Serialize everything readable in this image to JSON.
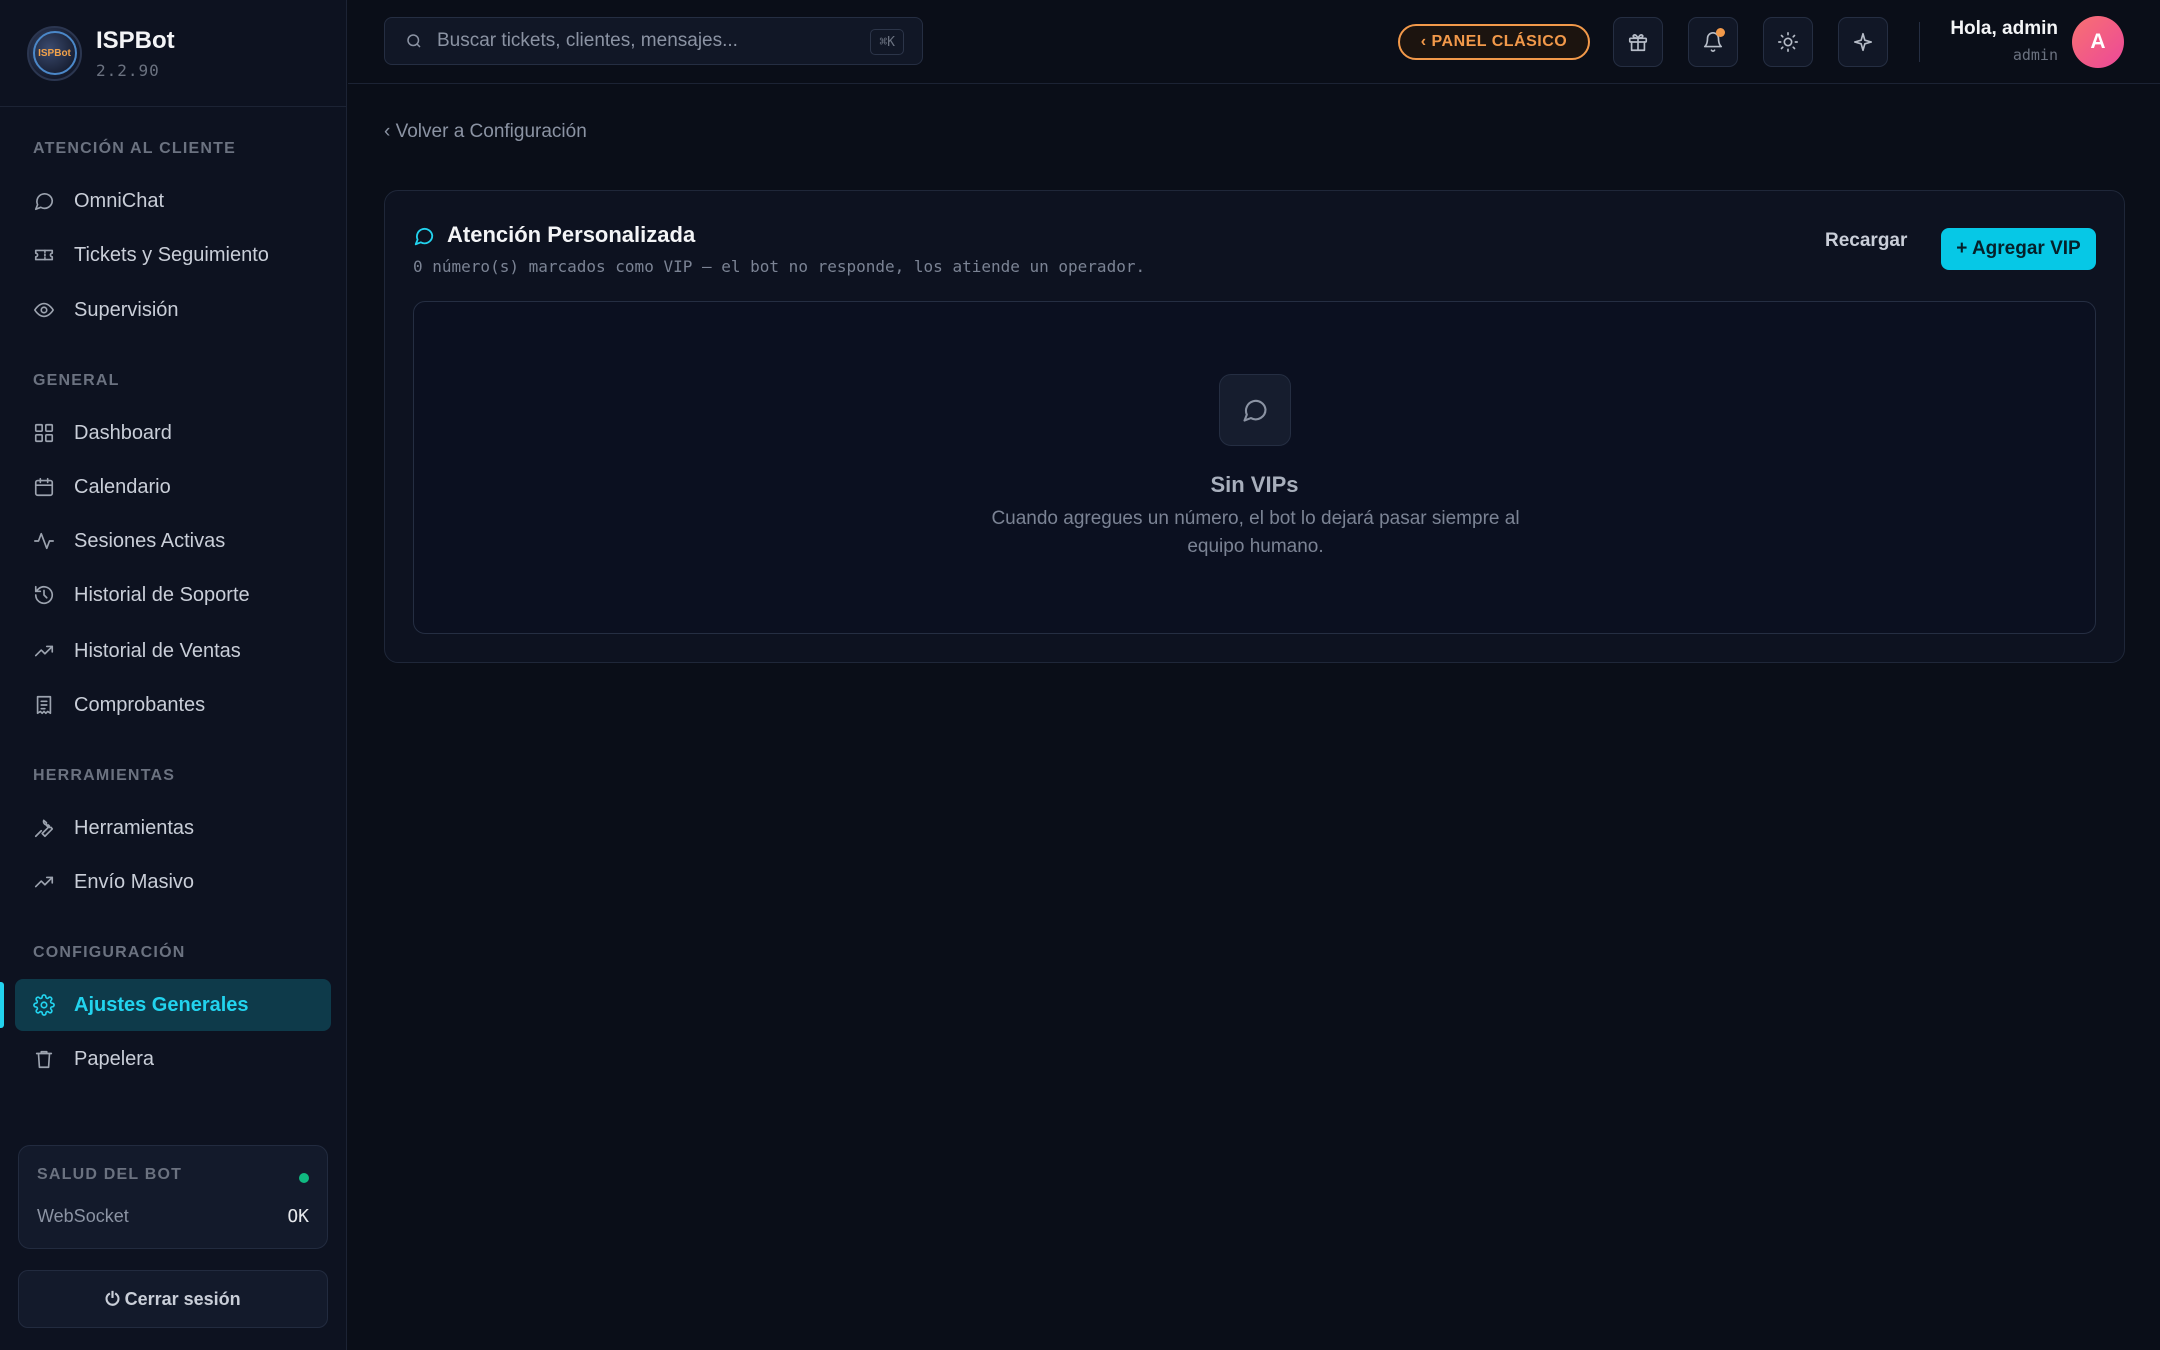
{
  "brand": {
    "name": "ISPBot",
    "version": "2.2.90",
    "logo_text": "ISPBot"
  },
  "sidebar": {
    "sections": [
      {
        "title": "ATENCIÓN AL CLIENTE",
        "items": [
          {
            "label": "OmniChat",
            "icon": "chat-bubble-icon"
          },
          {
            "label": "Tickets y Seguimiento",
            "icon": "ticket-icon"
          },
          {
            "label": "Supervisión",
            "icon": "eye-icon"
          }
        ]
      },
      {
        "title": "GENERAL",
        "items": [
          {
            "label": "Dashboard",
            "icon": "grid-icon"
          },
          {
            "label": "Calendario",
            "icon": "calendar-icon"
          },
          {
            "label": "Sesiones Activas",
            "icon": "activity-icon"
          },
          {
            "label": "Historial de Soporte",
            "icon": "history-icon"
          },
          {
            "label": "Historial de Ventas",
            "icon": "trending-up-icon"
          },
          {
            "label": "Comprobantes",
            "icon": "receipt-icon"
          }
        ]
      },
      {
        "title": "HERRAMIENTAS",
        "items": [
          {
            "label": "Herramientas",
            "icon": "wrench-icon"
          },
          {
            "label": "Envío Masivo",
            "icon": "trending-up-icon"
          }
        ]
      },
      {
        "title": "CONFIGURACIÓN",
        "items": [
          {
            "label": "Ajustes Generales",
            "icon": "gear-icon",
            "active": true
          },
          {
            "label": "Papelera",
            "icon": "trash-icon"
          }
        ]
      }
    ],
    "health": {
      "title": "SALUD DEL BOT",
      "status_color": "#10b981",
      "row_label": "WebSocket",
      "row_value": "OK"
    },
    "logout_label": "⏻ Cerrar sesión"
  },
  "topbar": {
    "search_placeholder": "Buscar tickets, clientes, mensajes...",
    "search_shortcut": "⌘K",
    "classic_panel_label": "‹ PANEL CLÁSICO",
    "user_greeting": "Hola, admin",
    "user_role": "admin",
    "avatar_initial": "A"
  },
  "main": {
    "back_link": "‹ Volver a Configuración",
    "card": {
      "title": "Atención Personalizada",
      "subtitle": "0 número(s) marcados como VIP — el bot no responde, los atiende un operador.",
      "reload_label": "Recargar",
      "add_label": "+ Agregar VIP",
      "empty_title": "Sin VIPs",
      "empty_desc": "Cuando agregues un número, el bot lo dejará pasar siempre al equipo humano."
    }
  },
  "colors": {
    "accent": "#22d3ee",
    "classic": "#f2994a",
    "background": "#0a0e18"
  }
}
